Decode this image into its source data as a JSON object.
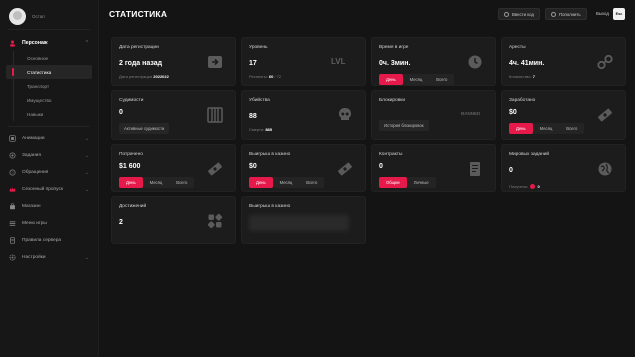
{
  "user": {
    "name": "Остап"
  },
  "sidebar": {
    "personal": {
      "label": "Персонаж",
      "items": [
        "Основное",
        "Статистика",
        "Транспорт",
        "Имущество",
        "Навыки"
      ]
    },
    "items": [
      {
        "label": "Анимации",
        "icon": "animation-icon"
      },
      {
        "label": "Задания",
        "icon": "tasks-icon"
      },
      {
        "label": "Обращения",
        "icon": "support-icon"
      },
      {
        "label": "Сезонный пропуск",
        "icon": "crown-icon"
      },
      {
        "label": "Магазин",
        "icon": "shop-icon"
      },
      {
        "label": "Меню игры",
        "icon": "menu-icon"
      },
      {
        "label": "Правила сервера",
        "icon": "rules-icon"
      },
      {
        "label": "Настройки",
        "icon": "settings-icon"
      }
    ]
  },
  "header": {
    "title": "СТАТИСТИКА",
    "redeem_code": "Ввести код",
    "top_up": "Пополнить",
    "exit_label": "Выход",
    "exit_key": "Esc"
  },
  "period": {
    "day": "День",
    "month": "Месяц",
    "all": "Всего"
  },
  "cards": {
    "reg": {
      "label": "Дата регистрации",
      "value": "2 года назад",
      "sub_prefix": "Дата регистрации",
      "sub_value": "2022022"
    },
    "level": {
      "label": "Уровень",
      "value": "17",
      "sub_prefix": "Респекты:",
      "sub_value": "60",
      "sub_suffix": "/ 72",
      "deco": "LVL"
    },
    "time": {
      "label": "Время в игре",
      "value": "0ч. 3мин."
    },
    "arrests": {
      "label": "Аресты",
      "value": "4ч. 41мин.",
      "sub_prefix": "Количество:",
      "sub_value": "7"
    },
    "convictions": {
      "label": "Судимости",
      "value": "0",
      "pill": "Активные судимости"
    },
    "kills": {
      "label": "Убийства",
      "value": "88",
      "sub_prefix": "Смерти:",
      "sub_value": "885"
    },
    "bans": {
      "label": "Блокировки",
      "pill": "История блокировок",
      "deco": "BANNED"
    },
    "earned": {
      "label": "Заработано",
      "value": "$0"
    },
    "spent": {
      "label": "Потрачено",
      "value": "$1 600"
    },
    "casino": {
      "label": "Выигрыш в казино",
      "value": "$0"
    },
    "contracts": {
      "label": "Контракты",
      "value": "0",
      "seg_common": "Общие",
      "seg_personal": "Личные"
    },
    "world": {
      "label": "Мировых заданий",
      "value": "0",
      "sub_prefix": "Получено:",
      "sub_value": "0"
    },
    "achievements": {
      "label": "Достижений",
      "value": "2"
    },
    "hidden": {
      "label": "Выигрыш в казино"
    }
  },
  "colors": {
    "accent": "#e6194b",
    "bg": "#141414",
    "card": "#1c1c1c"
  }
}
